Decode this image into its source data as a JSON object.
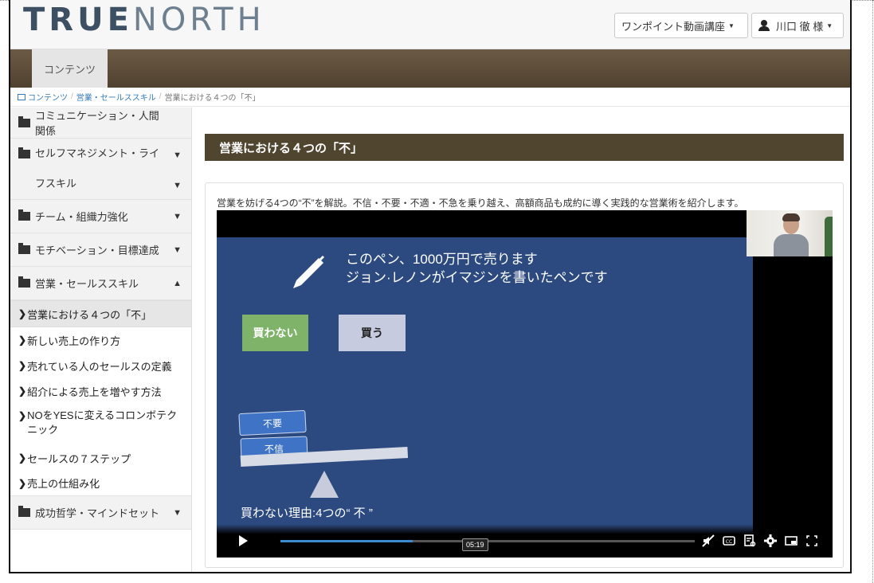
{
  "header": {
    "logo_part1": "TRUE",
    "logo_part2": "NORTH",
    "course_menu_label": "ワンポイント動画講座",
    "user_menu_label": "川口 徹 様"
  },
  "navbar": {
    "items": [
      {
        "label": "コンテンツ"
      }
    ]
  },
  "breadcrumb": {
    "items": [
      "コンテンツ",
      "営業・セールススキル",
      "営業における４つの「不」"
    ]
  },
  "sidebar": {
    "categories": [
      {
        "label": "コミュニケーション・人間関係",
        "expanded": false
      },
      {
        "label": "セルフマネジメント・ライフスキル",
        "expanded": false
      },
      {
        "label": "チーム・組織力強化",
        "expanded": false
      },
      {
        "label": "モチベーション・目標達成",
        "expanded": false
      },
      {
        "label": "営業・セールススキル",
        "expanded": true
      },
      {
        "label": "成功哲学・マインドセット",
        "expanded": false
      }
    ],
    "sub_items": [
      {
        "label": "営業における４つの「不」",
        "active": true
      },
      {
        "label": "新しい売上の作り方"
      },
      {
        "label": "売れている人のセールスの定義"
      },
      {
        "label": "紹介による売上を増やす方法"
      },
      {
        "label": "NOをYESに変えるコロンボテクニック"
      },
      {
        "label": "セールスの７ステップ"
      },
      {
        "label": "売上の仕組み化"
      }
    ]
  },
  "main": {
    "title": "営業における４つの「不」",
    "description": "営業を妨げる4つの“不”を解説。不信・不要・不適・不急を乗り越え、高額商品も成約に導く実践的な営業術を紹介します。"
  },
  "video": {
    "slide_line1": "このペン、1000万円で売ります",
    "slide_line2": "ジョン·レノンがイマジンを書いたペンです",
    "button_no": "買わない",
    "button_buy": "買う",
    "tag_1": "不要",
    "tag_2": "不信",
    "reason_text": "買わない理由:4つの“ 不 ”",
    "current_time": "05:19",
    "progress_fraction": 0.32
  },
  "colors": {
    "navbar": "#5c4c39",
    "title_bar": "#50452f",
    "slide_bg": "#2d4a80",
    "progress": "#3a8bd0"
  }
}
